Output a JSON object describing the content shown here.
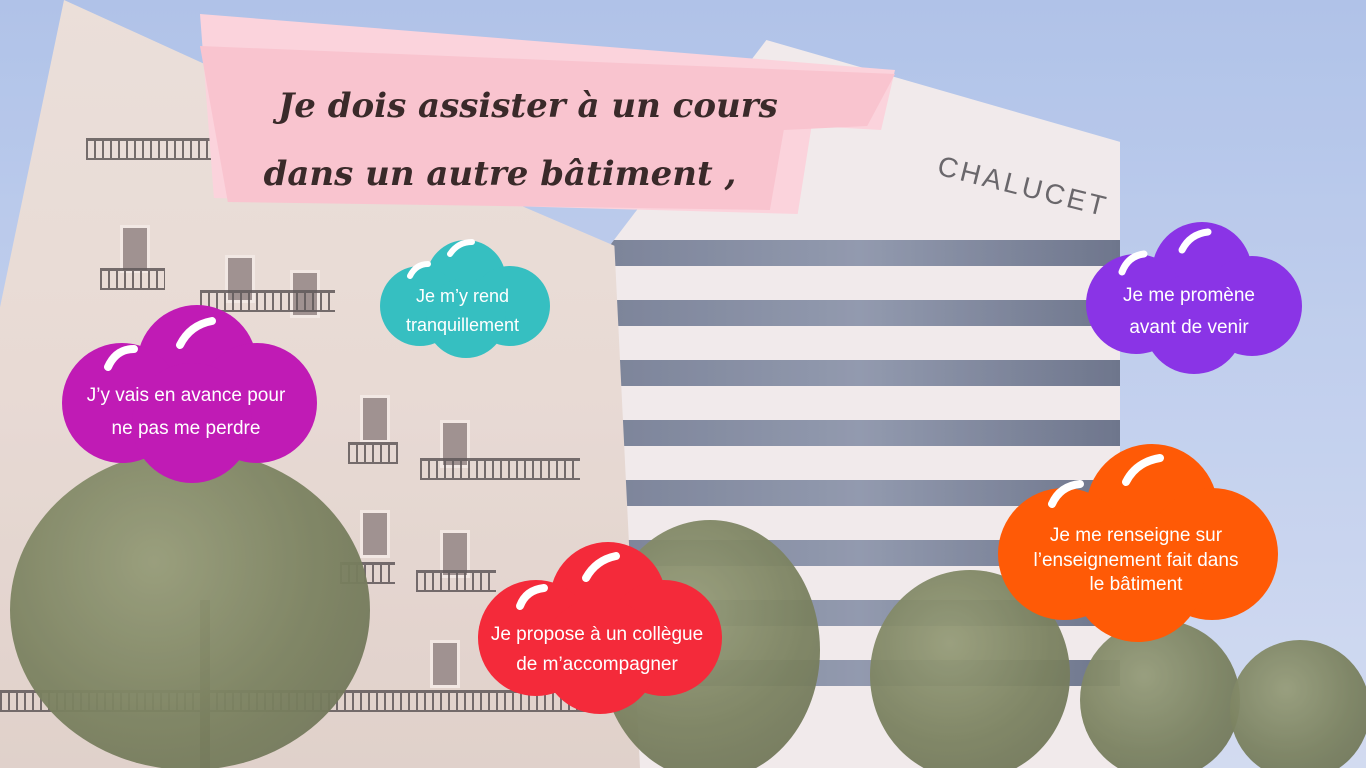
{
  "banner": {
    "line1": "Je dois assister à un cours",
    "line2": "dans un autre bâtiment ,"
  },
  "building_sign": "CHALUCET",
  "bubbles": {
    "walk": {
      "line1": "Je m’y rend",
      "line2": "tranquillement",
      "color": "#36bfc1"
    },
    "early": {
      "line1": "J’y vais en avance pour",
      "line2": "ne pas me perdre",
      "color": "#c01bb5"
    },
    "stroll": {
      "line1": "Je me promène",
      "line2": "avant de venir",
      "color": "#8a34e6"
    },
    "colleague": {
      "line1": "Je propose à un collègue",
      "line2": "de m’accompagner",
      "color": "#f42a3a"
    },
    "inform": {
      "line1": "Je me renseigne sur",
      "line2": "l’enseignement fait dans",
      "line3": "le bâtiment",
      "color": "#ff5a06"
    }
  },
  "colors": {
    "banner_pink": "#f9c4cf",
    "title_text": "#3a2a2a",
    "sky": "#a9c1ea"
  }
}
